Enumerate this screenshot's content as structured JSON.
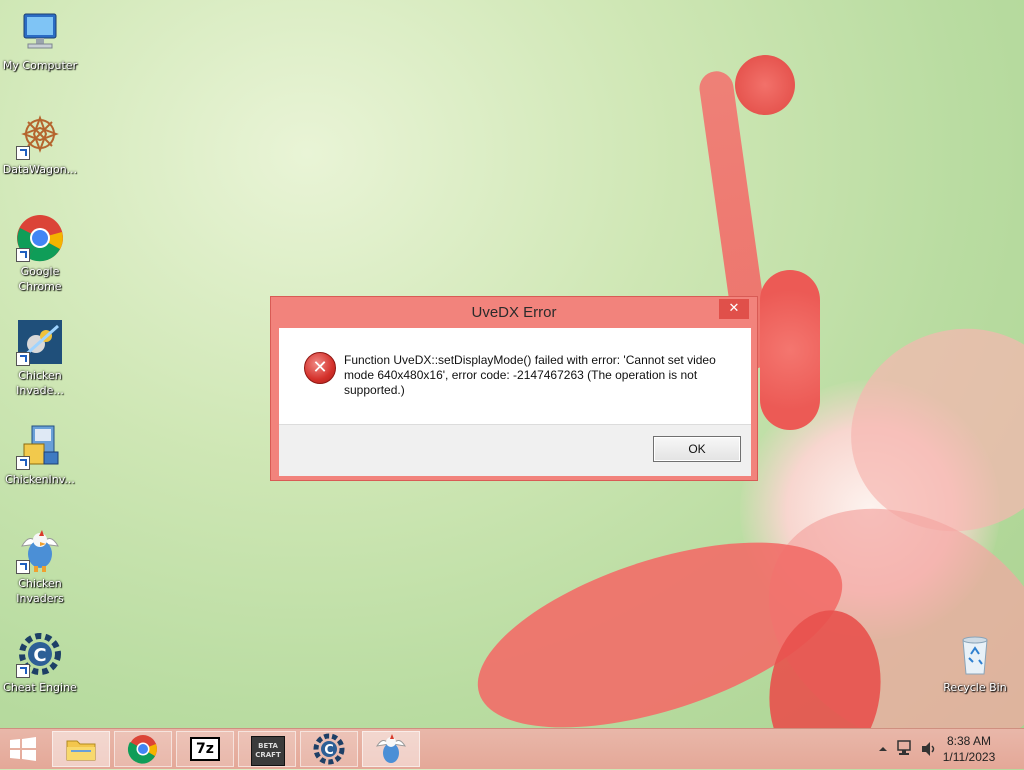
{
  "desktop": {
    "icons": [
      {
        "label": "My Computer"
      },
      {
        "label": "DataWagon..."
      },
      {
        "label": "Google Chrome"
      },
      {
        "label": "Chicken Invade..."
      },
      {
        "label": "ChickenInv..."
      },
      {
        "label": "Chicken Invaders"
      },
      {
        "label": "Cheat Engine"
      },
      {
        "label": "Recycle Bin"
      }
    ]
  },
  "dialog": {
    "title": "UveDX Error",
    "close_label": "✕",
    "message": "Function UveDX::setDisplayMode() failed with error: 'Cannot set video mode 640x480x16', error code: -2147467263 (The operation is not supported.)",
    "ok_label": "OK"
  },
  "taskbar": {
    "apps": [
      {
        "name": "File Explorer"
      },
      {
        "name": "Google Chrome"
      },
      {
        "name": "7-Zip"
      },
      {
        "name": "BetaCraft"
      },
      {
        "name": "Cheat Engine"
      },
      {
        "name": "Chicken Invaders"
      }
    ],
    "sevenzip_text": "7z",
    "betacraft_text": "BETA CRAFT",
    "time": "8:38 AM",
    "date": "1/11/2023"
  }
}
